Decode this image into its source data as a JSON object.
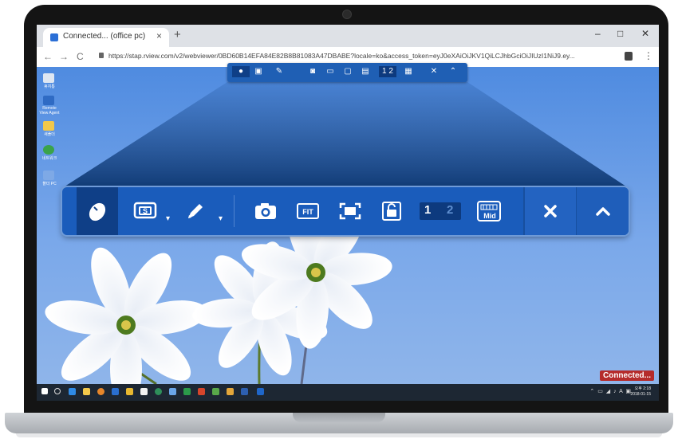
{
  "browser": {
    "tab_title": "Connected... (office pc)",
    "tab_close": "×",
    "new_tab": "+",
    "minimize": "–",
    "maximize": "□",
    "close": "✕",
    "back": "←",
    "forward": "→",
    "reload": "C",
    "url": "https://stap.rview.com/v2/webviewer/0BD60B14EFA84E82B8B81083A47DBABE?locale=ko&access_token=eyJ0eXAiOiJKV1QiLCJhbGciOiJIUzI1NiJ9.ey..."
  },
  "desktop": {
    "icons": [
      "휴지통",
      "Remote View Agent",
      "새폴더",
      "네트워크",
      "폴더 PC"
    ]
  },
  "status": {
    "connected_label": "Connected..."
  },
  "taskbar": {
    "clock_time": "오후 2:18",
    "clock_date": "2018-01-15"
  },
  "toolbar": {
    "monitor_1": "1",
    "monitor_2": "2",
    "close_symbol": "✕",
    "collapse_symbol": "^",
    "fit_label": "FIT",
    "mid_label": "Mid",
    "s_label": "S"
  },
  "colors": {
    "toolbar_bg": "#1a5cbb",
    "active_btn": "#0f3f87",
    "connected_badge": "#b52b2b"
  },
  "icons": [
    "mouse-icon",
    "keyboard-s-icon",
    "pen-icon",
    "camera-icon",
    "fit-icon",
    "fullscreen-icon",
    "lock-icon",
    "keyboard-mid-icon",
    "close-icon",
    "chevron-up-icon"
  ]
}
